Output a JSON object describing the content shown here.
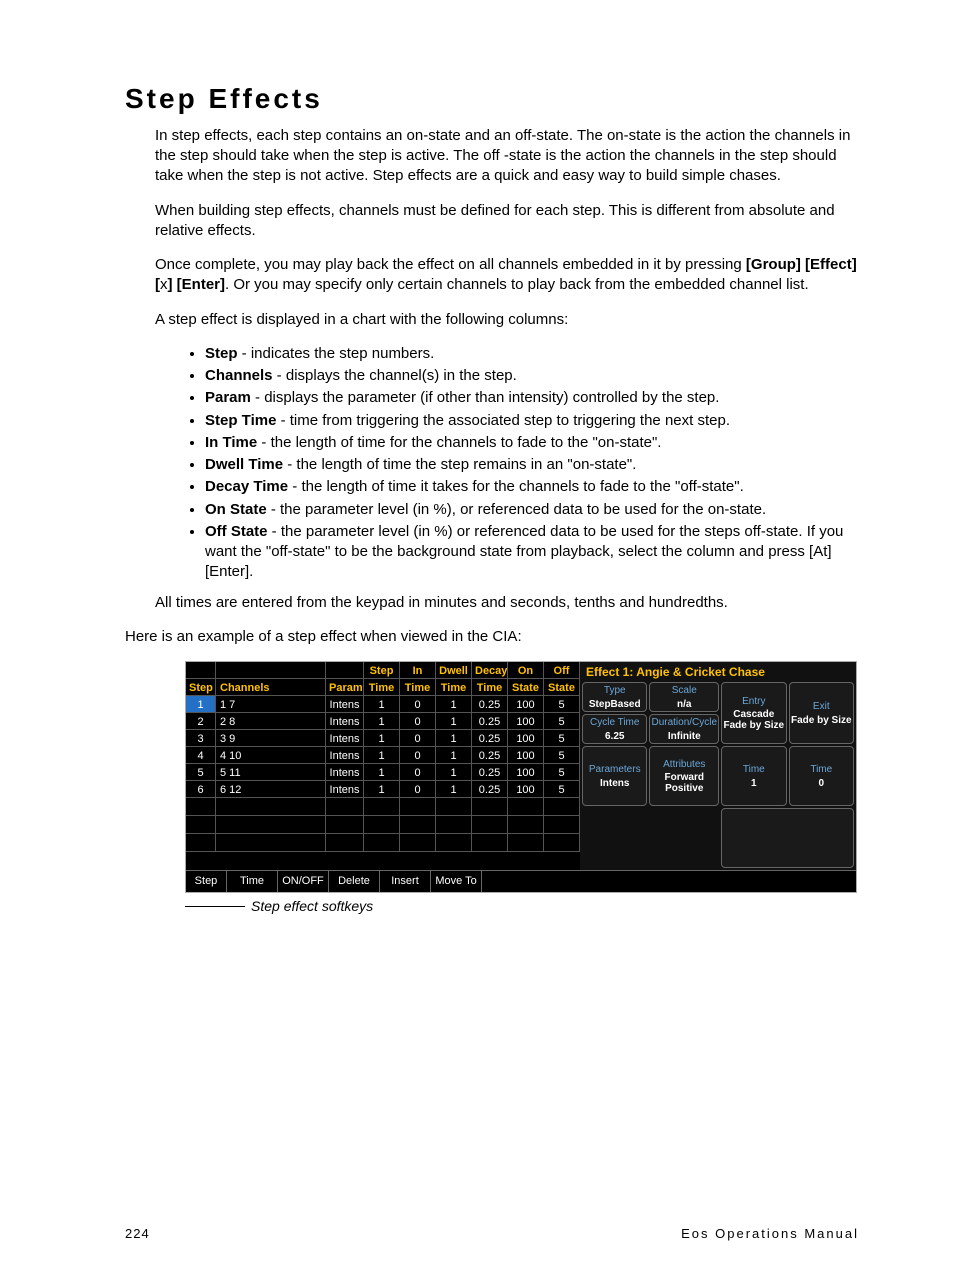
{
  "title": "Step Effects",
  "para1": "In step effects, each step contains an on-state and an off-state. The on-state is the action the channels in the step should take when the step is active. The off -state is the action the channels in the step should take when the step is not active. Step effects are a quick and easy way to build simple chases.",
  "para2": "When building step effects, channels must be defined for each step. This is different from absolute and relative effects.",
  "para3a": "Once complete, you may play back the effect on all channels embedded in it by pressing ",
  "para3b": "[Group] [Effect] [",
  "para3c": "x",
  "para3d": "] [Enter]",
  "para3e": ". Or you may specify only certain channels to play back from the embedded channel list.",
  "para4": "A step effect is displayed in a chart with the following columns:",
  "bullets": [
    {
      "b": "Step",
      "t": " - indicates the step numbers."
    },
    {
      "b": "Channels",
      "t": " - displays the channel(s) in the step."
    },
    {
      "b": "Param",
      "t": " - displays the parameter (if other than intensity) controlled by the step."
    },
    {
      "b": "Step Time",
      "t": " - time from triggering the associated step to triggering the next step."
    },
    {
      "b": "In Time",
      "t": " - the length of time for the channels to fade to the \"on-state\"."
    },
    {
      "b": "Dwell Time",
      "t": " - the length of time the step remains in an \"on-state\"."
    },
    {
      "b": "Decay Time",
      "t": " - the length of time it takes for the channels to fade to the \"off-state\"."
    },
    {
      "b": "On State",
      "t": " - the parameter level (in %), or referenced data to be used for the on-state."
    },
    {
      "b": "Off State",
      "t": " - the parameter level (in %) or referenced data to be used for the steps off-state. If you want the \"off-state\" to be the background state from playback, select the column and press [At] [Enter]."
    }
  ],
  "para5": "All times are entered from the keypad in minutes and seconds, tenths and hundredths.",
  "para6": "Here is an example of a step effect when viewed in the CIA:",
  "table": {
    "headers_top": [
      "",
      "",
      "",
      "Step",
      "In",
      "Dwell",
      "Decay",
      "On",
      "Off"
    ],
    "headers_bot": [
      "Step",
      "Channels",
      "Param",
      "Time",
      "Time",
      "Time",
      "Time",
      "State",
      "State"
    ],
    "rows": [
      {
        "sel": true,
        "c": [
          "1",
          "1 7",
          "Intens",
          "1",
          "0",
          "1",
          "0.25",
          "100",
          "5"
        ]
      },
      {
        "sel": false,
        "c": [
          "2",
          "2 8",
          "Intens",
          "1",
          "0",
          "1",
          "0.25",
          "100",
          "5"
        ]
      },
      {
        "sel": false,
        "c": [
          "3",
          "3 9",
          "Intens",
          "1",
          "0",
          "1",
          "0.25",
          "100",
          "5"
        ]
      },
      {
        "sel": false,
        "c": [
          "4",
          "4 10",
          "Intens",
          "1",
          "0",
          "1",
          "0.25",
          "100",
          "5"
        ]
      },
      {
        "sel": false,
        "c": [
          "5",
          "5 11",
          "Intens",
          "1",
          "0",
          "1",
          "0.25",
          "100",
          "5"
        ]
      },
      {
        "sel": false,
        "c": [
          "6",
          "6 12",
          "Intens",
          "1",
          "0",
          "1",
          "0.25",
          "100",
          "5"
        ]
      }
    ]
  },
  "fx": {
    "title": "Effect 1: Angie & Cricket Chase",
    "type_lbl": "Type",
    "type_val": "StepBased",
    "scale_lbl": "Scale",
    "scale_val": "n/a",
    "entry_lbl": "Entry",
    "entry_val": "Cascade Fade by Size",
    "exit_lbl": "Exit",
    "exit_val": "Fade by Size",
    "cycle_lbl": "Cycle Time",
    "cycle_val": "6.25",
    "dur_lbl": "Duration/Cycle",
    "dur_val": "Infinite",
    "time1_lbl": "Time",
    "time1_val": "1",
    "time2_lbl": "Time",
    "time2_val": "0",
    "param_lbl": "Parameters",
    "param_val": "Intens",
    "attr_lbl": "Attributes",
    "attr_val": "Forward Positive"
  },
  "softkeys": [
    "Step",
    "Time",
    "ON/OFF",
    "Delete",
    "Insert",
    "Move To"
  ],
  "caption": "Step effect softkeys",
  "footer_page": "224",
  "footer_doc": "Eos Operations Manual"
}
